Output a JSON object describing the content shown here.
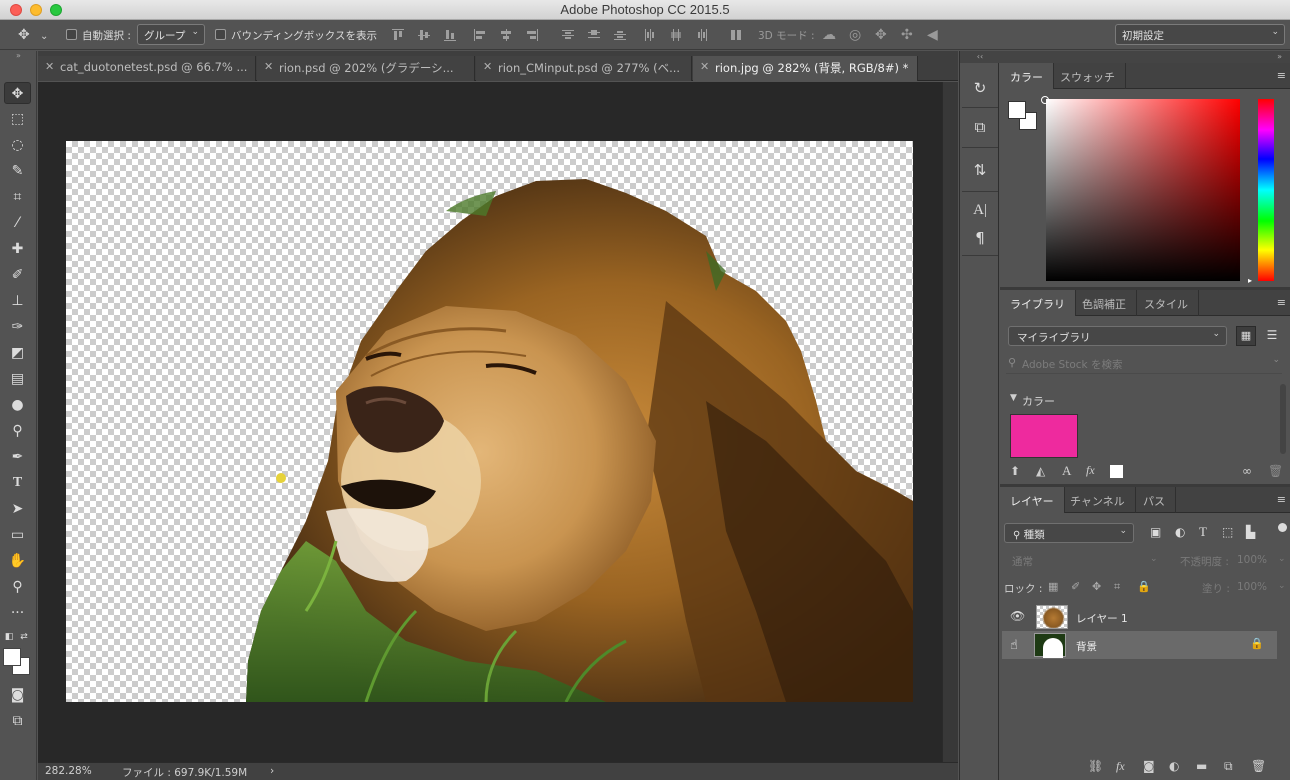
{
  "window": {
    "title": "Adobe Photoshop CC 2015.5"
  },
  "options_bar": {
    "auto_select_label": "自動選択 :",
    "auto_select_value": "グループ",
    "bounding_box_label": "バウンディングボックスを表示",
    "mode_3d_label": "3D モード :",
    "workspace_value": "初期設定"
  },
  "tabs": [
    {
      "label": "cat_duotonetest.psd @ 66.7% ..."
    },
    {
      "label": "rion.psd @ 202% (グラデーシ..."
    },
    {
      "label": "rion_CMinput.psd @ 277% (ベ..."
    },
    {
      "label": "rion.jpg @ 282% (背景, RGB/8#) *"
    }
  ],
  "status": {
    "zoom": "282.28%",
    "file_info": "ファイル : 697.9K/1.59M",
    "arrow": "›"
  },
  "color_panel": {
    "tabs": [
      "カラー",
      "スウォッチ"
    ],
    "foreground": "#ffffff",
    "background": "#ffffff"
  },
  "library_panel": {
    "tabs": [
      "ライブラリ",
      "色調補正",
      "スタイル"
    ],
    "library_select": "マイライブラリ",
    "search_placeholder": "Adobe Stock を検索",
    "colors_header": "カラー",
    "swatch_color": "#ee2a9e",
    "fx_label": "fx",
    "text_label": "A"
  },
  "layers_panel": {
    "tabs": [
      "レイヤー",
      "チャンネル",
      "パス"
    ],
    "filter_select": "種類",
    "blend_mode": "通常",
    "opacity_label": "不透明度 :",
    "opacity_value": "100%",
    "lock_label": "ロック :",
    "fill_label": "塗り :",
    "fill_value": "100%",
    "layers": [
      {
        "name": "レイヤー 1",
        "visible": true,
        "selected": false,
        "locked": false
      },
      {
        "name": "背景",
        "visible": false,
        "selected": true,
        "locked": true
      }
    ],
    "fx_label": "fx"
  }
}
